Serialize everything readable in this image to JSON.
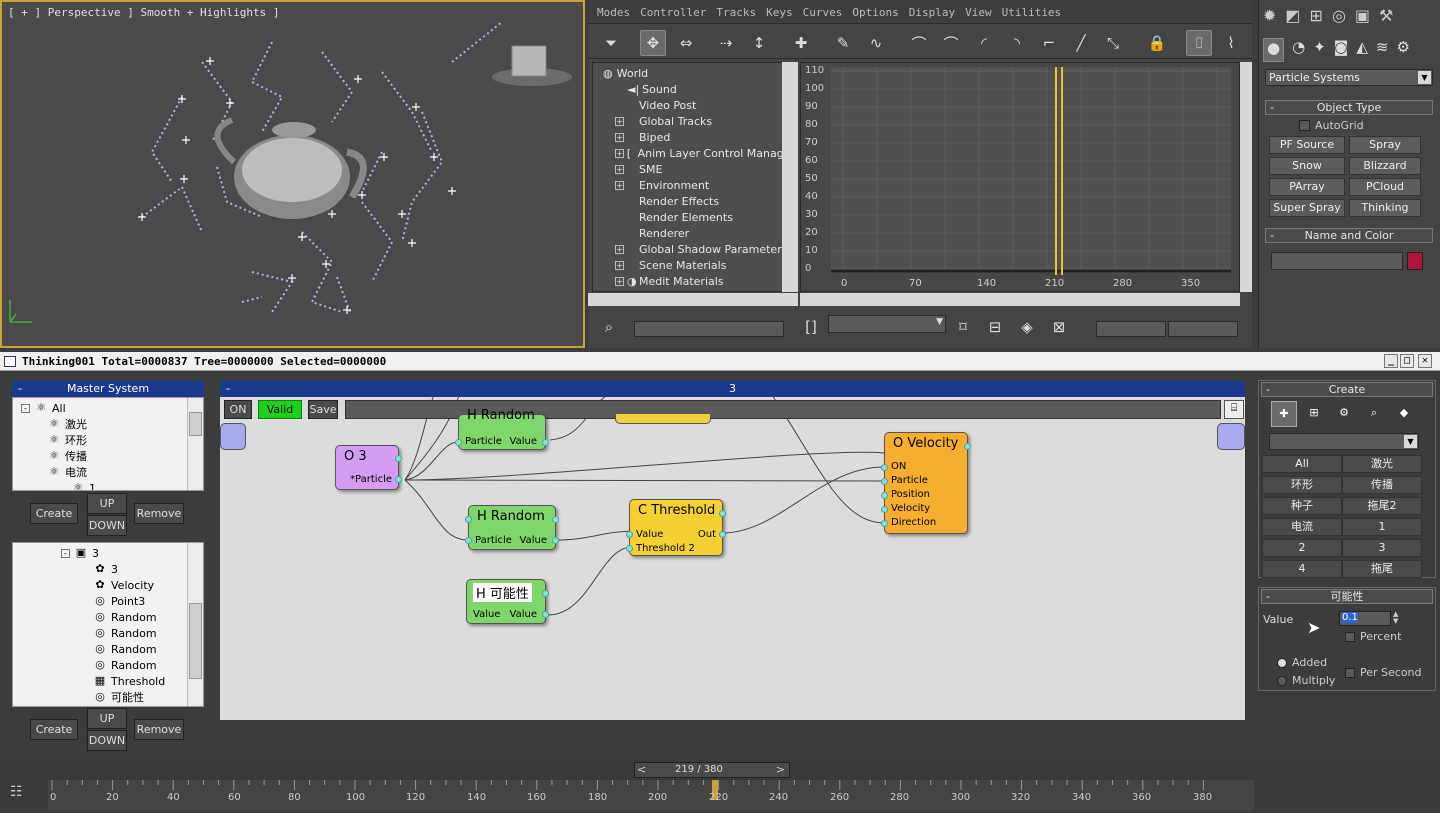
{
  "viewport": {
    "label": "[ + ] Perspective ] Smooth + Highlights ]"
  },
  "trackview": {
    "menu": [
      "Modes",
      "Controller",
      "Tracks",
      "Keys",
      "Curves",
      "Options",
      "Display",
      "View",
      "Utilities"
    ],
    "tree": [
      {
        "label": "World",
        "exp": ""
      },
      {
        "label": "Sound",
        "exp": ""
      },
      {
        "label": "Video Post",
        "exp": ""
      },
      {
        "label": "Global Tracks",
        "exp": "+"
      },
      {
        "label": "Biped",
        "exp": "+"
      },
      {
        "label": "Anim Layer Control Manager",
        "exp": "+"
      },
      {
        "label": "SME",
        "exp": "+"
      },
      {
        "label": "Environment",
        "exp": "+"
      },
      {
        "label": "Render Effects",
        "exp": ""
      },
      {
        "label": "Render Elements",
        "exp": ""
      },
      {
        "label": "Renderer",
        "exp": ""
      },
      {
        "label": "Global Shadow Parameters",
        "exp": "+"
      },
      {
        "label": "Scene Materials",
        "exp": "+"
      },
      {
        "label": "Medit Materials",
        "exp": "+"
      }
    ],
    "y_ticks": [
      "110",
      "100",
      "90",
      "80",
      "70",
      "60",
      "50",
      "40",
      "30",
      "20",
      "10",
      "0"
    ],
    "x_ticks": [
      "0",
      "70",
      "140",
      "210",
      "280",
      "350"
    ]
  },
  "cmd": {
    "dropdown": "Particle Systems",
    "object_type_title": "Object Type",
    "autogrid": "AutoGrid",
    "buttons": [
      "PF Source",
      "Spray",
      "Snow",
      "Blizzard",
      "PArray",
      "PCloud",
      "Super Spray",
      "Thinking"
    ],
    "name_color_title": "Name and Color",
    "color": "#b0143c"
  },
  "dialog": {
    "title": "Thinking001   Total=0000837  Tree=0000000  Selected=0000000",
    "master_title": "Master System",
    "master_tree": [
      {
        "label": "All",
        "exp": "-"
      },
      {
        "label": "激光",
        "exp": ""
      },
      {
        "label": "环形",
        "exp": ""
      },
      {
        "label": "传播",
        "exp": "+"
      },
      {
        "label": "电流",
        "exp": "-"
      },
      {
        "label": "1",
        "exp": ""
      }
    ],
    "node_tree": [
      {
        "label": "3",
        "ic": "▣"
      },
      {
        "label": "3",
        "ic": "✿"
      },
      {
        "label": "Velocity",
        "ic": "✿"
      },
      {
        "label": "Point3",
        "ic": "◎"
      },
      {
        "label": "Random",
        "ic": "◎"
      },
      {
        "label": "Random",
        "ic": "◎"
      },
      {
        "label": "Random",
        "ic": "◎"
      },
      {
        "label": "Random",
        "ic": "◎"
      },
      {
        "label": "Threshold",
        "ic": "▦"
      },
      {
        "label": "可能性",
        "ic": "◎"
      }
    ],
    "create": "Create",
    "up": "UP",
    "down": "DOWN",
    "remove": "Remove",
    "editor_title": "3",
    "on": "ON",
    "valid": "Valid",
    "save": "Save",
    "nodes": {
      "o3": {
        "title": "O 3",
        "port": "*Particle"
      },
      "hrandom_top": {
        "title": "H Random",
        "in": "Particle",
        "out": "Value"
      },
      "hrandom": {
        "title": "H Random",
        "in": "Particle",
        "out": "Value"
      },
      "hposs": {
        "title": "H 可能性",
        "in": "Value",
        "out": "Value"
      },
      "threshold": {
        "title": "C Threshold",
        "in1": "Value",
        "in2": "Threshold 2",
        "out": "Out"
      },
      "velocity": {
        "title": "O Velocity",
        "ports": [
          "ON",
          "Particle",
          "Position",
          "Velocity",
          "Direction"
        ]
      }
    },
    "right": {
      "create_title": "Create",
      "cat_buttons": [
        "All",
        "激光",
        "环形",
        "传播",
        "种子",
        "拖尾2",
        "电流",
        "1",
        "2",
        "3",
        "4",
        "拖尾"
      ],
      "param_title": "可能性",
      "value_label": "Value",
      "value": "0.1",
      "percent": "Percent",
      "added": "Added",
      "multiply": "Multiply",
      "per_second": "Per Second"
    }
  },
  "timeline": {
    "frame": "219 / 380",
    "ticks": [
      "0",
      "20",
      "40",
      "60",
      "80",
      "100",
      "120",
      "140",
      "160",
      "180",
      "200",
      "220",
      "240",
      "260",
      "280",
      "300",
      "320",
      "340",
      "360",
      "380"
    ]
  }
}
